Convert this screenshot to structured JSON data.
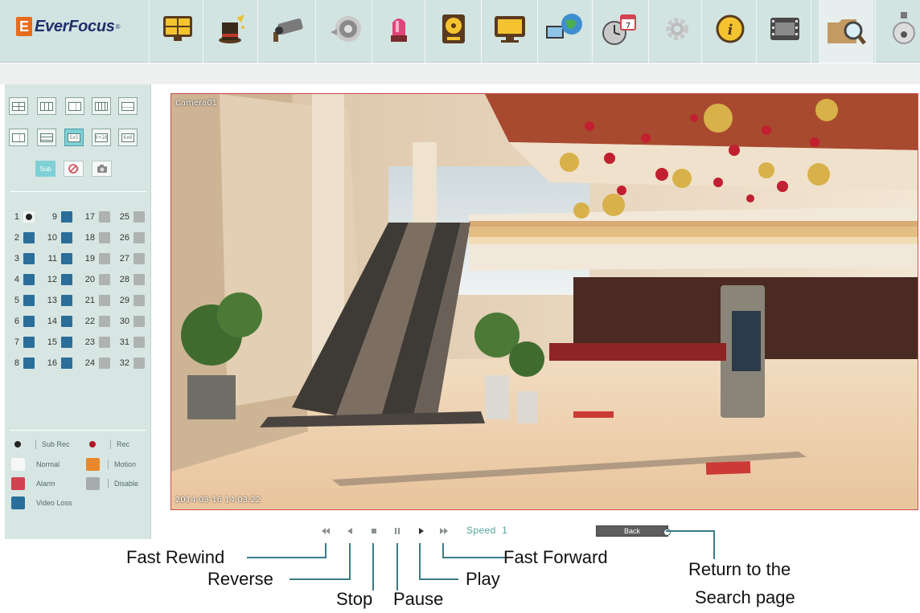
{
  "logo": {
    "brand": "EverFocus",
    "mark": "E",
    "reg": "®"
  },
  "toolbar": {
    "items": [
      {
        "icon": "display-icon"
      },
      {
        "icon": "wizard-hat-icon"
      },
      {
        "icon": "camera-icon"
      },
      {
        "icon": "record-icon"
      },
      {
        "icon": "alarm-light-icon"
      },
      {
        "icon": "hard-disk-icon"
      },
      {
        "icon": "monitor-icon"
      },
      {
        "icon": "network-globe-icon"
      },
      {
        "icon": "schedule-icon"
      },
      {
        "icon": "gear-icon"
      },
      {
        "icon": "info-icon"
      },
      {
        "icon": "film-icon"
      },
      {
        "icon": "search-folder-icon"
      },
      {
        "icon": "ptz-dome-icon"
      }
    ]
  },
  "layouts": {
    "row2_labels": [
      "",
      "",
      "5x5",
      "4+28",
      "6x6"
    ]
  },
  "small_buttons": {
    "sub": "Sub"
  },
  "channels": {
    "columns": [
      [
        "1",
        "2",
        "3",
        "4",
        "5",
        "6",
        "7",
        "8"
      ],
      [
        "9",
        "10",
        "11",
        "12",
        "13",
        "14",
        "15",
        "16"
      ],
      [
        "17",
        "18",
        "19",
        "20",
        "21",
        "22",
        "23",
        "24"
      ],
      [
        "25",
        "26",
        "27",
        "28",
        "29",
        "30",
        "31",
        "32"
      ]
    ]
  },
  "legend": {
    "sub_rec": "Sub Rec",
    "rec": "Rec",
    "normal": "Normal",
    "motion": "Motion",
    "alarm": "Alarm",
    "disable": "Disable",
    "video_loss": "Video Loss"
  },
  "colors": {
    "normal": "#f7f7f7",
    "motion": "#e8882a",
    "alarm": "#d0434f",
    "disable": "#a7abab",
    "video_loss": "#2a6f9b",
    "rec": "#b0172a"
  },
  "video": {
    "camera_label": "Camera01",
    "timestamp": "2014-03-16 14:03:22"
  },
  "playback": {
    "speed_label": "Speed",
    "speed_value": "1",
    "back_label": "Back"
  },
  "annotations": {
    "fast_rewind": "Fast Rewind",
    "reverse": "Reverse",
    "stop": "Stop",
    "pause": "Pause",
    "play": "Play",
    "fast_forward": "Fast Forward",
    "return_line1": "Return to the",
    "return_line2": "Search page"
  }
}
